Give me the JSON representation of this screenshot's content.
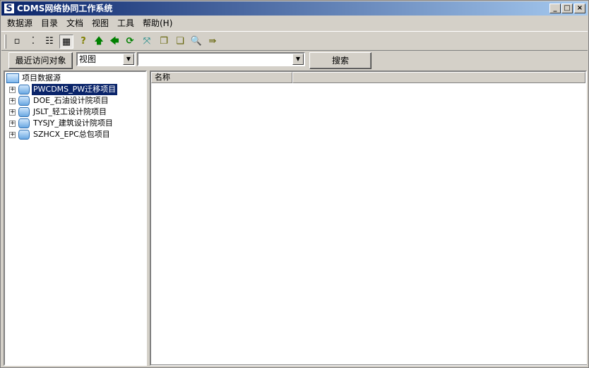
{
  "window": {
    "title": "CDMS网络协同工作系统",
    "icon_letter": "S",
    "controls": [
      "_",
      "□",
      "×"
    ]
  },
  "menu": [
    "数据源",
    "目录",
    "文档",
    "视图",
    "工具",
    "帮助(H)"
  ],
  "toolbar": {
    "icons": [
      {
        "name": "large-icons-view-icon",
        "glyph": "▫"
      },
      {
        "name": "small-icons-view-icon",
        "glyph": "⁚"
      },
      {
        "name": "list-view-icon",
        "glyph": "☷"
      },
      {
        "name": "details-view-icon",
        "glyph": "▦",
        "pressed": true
      },
      {
        "name": "help-icon",
        "glyph": "?"
      },
      {
        "name": "up-arrow-icon",
        "glyph": "🡅"
      },
      {
        "name": "back-arrow-icon",
        "glyph": "🡄"
      },
      {
        "name": "refresh-icon",
        "glyph": "⟳"
      },
      {
        "name": "expand-icon",
        "glyph": "⤧"
      },
      {
        "name": "copy-documents-icon",
        "glyph": "❐"
      },
      {
        "name": "paste-documents-icon",
        "glyph": "❏"
      },
      {
        "name": "search-icon",
        "glyph": "🔍"
      },
      {
        "name": "export-icon",
        "glyph": "⇛"
      }
    ]
  },
  "searchbar": {
    "recent_button": "最近访问对象",
    "view_select": "视图",
    "query_value": "",
    "search_button": "搜索"
  },
  "tree": {
    "root": "项目数据源",
    "items": [
      {
        "label": "PWCDMS_PW迁移项目",
        "selected": true
      },
      {
        "label": "DOE_石油设计院项目",
        "selected": false
      },
      {
        "label": "JSLT_轻工设计院项目",
        "selected": false
      },
      {
        "label": "TYSJY_建筑设计院项目",
        "selected": false
      },
      {
        "label": "SZHCX_EPC总包项目",
        "selected": false
      }
    ]
  },
  "list": {
    "columns": [
      "名称",
      ""
    ]
  },
  "colors": {
    "title_bar": "#0a246a",
    "selection": "#0a246a",
    "face": "#d4d0c8"
  }
}
